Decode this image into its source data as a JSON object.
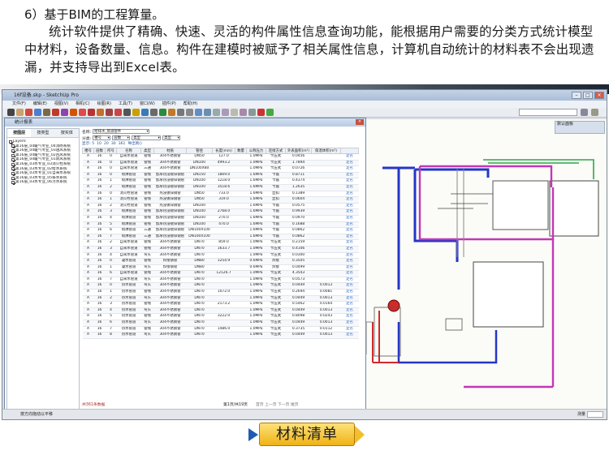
{
  "slide": {
    "heading": "6）基于BIM的工程算量。",
    "paragraph": "统计软件提供了精确、快速、灵活的构件属性信息查询功能，能根据用户需要的分类方式统计模型中材料，设备数量、信息。构件在建模时被赋予了相关属性信息，计算机自动统计的材料表不会出现遗漏，并支持导出到Excel表。"
  },
  "app": {
    "title": "16f设备.skp - SketchUp Pro",
    "menu": [
      "文件(F)",
      "编辑(E)",
      "视图(V)",
      "相机(C)",
      "绘图(R)",
      "工具(T)",
      "窗口(W)",
      "插件(P)",
      "帮助(H)"
    ],
    "status_text": "按方向拖动以平移",
    "status_right": "测量",
    "tray_title": "默认面板"
  },
  "dialog": {
    "title": "统计报表",
    "close_glyph": "×",
    "tabs": [
      "按图层",
      "按类型",
      "按实体"
    ],
    "tree": [
      {
        "label": "Layer0",
        "checked": true,
        "child": false
      },
      {
        "label": "第16层_04暖气专业_04消防系统",
        "checked": true,
        "child": true
      },
      {
        "label": "第16层_04暖气专业_03送风系统",
        "checked": true,
        "child": true
      },
      {
        "label": "第16层_04暖气专业_02回风系统",
        "checked": true,
        "child": true
      },
      {
        "label": "第16层_04暖气专业_01新风系统",
        "checked": true,
        "child": true
      },
      {
        "label": "第16层_03水专业_03消火栓系统",
        "checked": true,
        "child": true
      },
      {
        "label": "第16层_03水专业_02给水系统",
        "checked": true,
        "child": true
      },
      {
        "label": "第16层_03水专业_01自来水系统",
        "checked": true,
        "child": true
      },
      {
        "label": "第16层_03水专业_05排水系统",
        "checked": true,
        "child": true
      },
      {
        "label": "第16层_03水专业_06污水系统",
        "checked": true,
        "child": true
      }
    ],
    "filters": {
      "name_label": "名称:",
      "name_value": "给排水_管道管件",
      "type_label": "分类:",
      "sel1": "楼号",
      "sel2": "层数",
      "sel3": "类型",
      "sel4": "类型"
    },
    "counts": [
      "显示: 5",
      "10",
      "20",
      "30",
      "361",
      "导出到()"
    ],
    "columns": [
      "楼号",
      "层数",
      "所号",
      "名称",
      "类型",
      "材质",
      "管径",
      "长度(mm)",
      "数量",
      "公称压力",
      "连接方式",
      "外表面积(m²)",
      "保温体积(m³)",
      ""
    ],
    "rows": [
      [
        "A",
        "16",
        "0",
        "自来水管道",
        "管线",
        "304不锈钢管",
        "DN50",
        "127.0",
        "",
        "1.0MPa",
        "卡压式",
        "0.0456",
        "",
        "定名"
      ],
      [
        "A",
        "16",
        "0",
        "自来水管道",
        "管线",
        "304不锈钢管",
        "DN100",
        "4993.2",
        "",
        "1.0MPa",
        "卡压式",
        "1.7894",
        "",
        "定名"
      ],
      [
        "A",
        "16",
        "0",
        "自来水管道",
        "三通",
        "304不锈钢管",
        "DN100X80",
        "",
        "",
        "1.0MPa",
        "卡压式",
        "0.0726",
        "",
        "定名"
      ],
      [
        "A",
        "16",
        "0",
        "喷淋管道",
        "管线",
        "加厚热浸镀锌钢管",
        "DN150",
        "1869.0",
        "",
        "1.6MPa",
        "卡箍",
        "0.8711",
        "",
        "定名"
      ],
      [
        "A",
        "16",
        "1",
        "喷淋管道",
        "管线",
        "加厚热浸镀锌钢管",
        "DN100",
        "1218.0",
        "",
        "1.6MPa",
        "卡箍",
        "0.4374",
        "",
        "定名"
      ],
      [
        "A",
        "16",
        "2",
        "喷淋管道",
        "管线",
        "加厚热浸镀锌钢管",
        "DN100",
        "3518.6",
        "",
        "1.6MPa",
        "卡箍",
        "1.2635",
        "",
        "定名"
      ],
      [
        "A",
        "16",
        "0",
        "消火栓管道",
        "管线",
        "热浸镀锌钢管",
        "DN50",
        "733.0",
        "",
        "1.6MPa",
        "丝扣",
        "0.1389",
        "",
        "定名"
      ],
      [
        "A",
        "16",
        "1",
        "消火栓管道",
        "管线",
        "热浸镀锌钢管",
        "DN50",
        "319.0",
        "",
        "1.6MPa",
        "丝扣",
        "0.0604",
        "",
        "定名"
      ],
      [
        "A",
        "16",
        "2",
        "消火栓管道",
        "管线",
        "热浸镀锌钢管",
        "DN100",
        "",
        "",
        "1.6MPa",
        "卡箍",
        "0.0575",
        "",
        "定名"
      ],
      [
        "A",
        "16",
        "3",
        "喷淋管道",
        "管线",
        "加厚热浸镀锌钢管",
        "DN100",
        "2768.0",
        "",
        "1.6MPa",
        "卡箍",
        "0.9939",
        "",
        "定名"
      ],
      [
        "A",
        "16",
        "4",
        "喷淋管道",
        "管线",
        "加厚热浸镀锌钢管",
        "DN100",
        "270.0",
        "",
        "1.6MPa",
        "卡箍",
        "0.0970",
        "",
        "定名"
      ],
      [
        "A",
        "16",
        "5",
        "喷淋管道",
        "管线",
        "加厚热浸镀锌钢管",
        "DN100",
        "470.0",
        "",
        "1.6MPa",
        "卡箍",
        "0.1688",
        "",
        "定名"
      ],
      [
        "A",
        "16",
        "6",
        "喷淋管道",
        "三通",
        "加厚热浸镀锌钢管",
        "DN100X100",
        "",
        "",
        "1.6MPa",
        "卡箍",
        "0.0862",
        "",
        "定名"
      ],
      [
        "A",
        "16",
        "7",
        "喷淋管道",
        "三通",
        "加厚热浸镀锌钢管",
        "DN100X100",
        "",
        "",
        "1.6MPa",
        "卡箍",
        "0.0862",
        "",
        "定名"
      ],
      [
        "A",
        "16",
        "2",
        "自来水管道",
        "管线",
        "304不锈钢管",
        "DN70",
        "859.0",
        "",
        "1.0MPa",
        "卡压式",
        "0.2159",
        "",
        "定名"
      ],
      [
        "A",
        "16",
        "3",
        "自来水管道",
        "管线",
        "304不锈钢管",
        "DN70",
        "1633.7",
        "",
        "1.0MPa",
        "卡压式",
        "0.4106",
        "",
        "定名"
      ],
      [
        "A",
        "16",
        "4",
        "自来水管道",
        "弯头",
        "304不锈钢管",
        "DN70",
        "",
        "",
        "1.0MPa",
        "卡压式",
        "0.0300",
        "",
        "定名"
      ],
      [
        "A",
        "16",
        "0",
        "凝水管道",
        "管线",
        "焊接钢管",
        "DN80",
        "1254.9",
        "",
        "0.6MPa",
        "焊接",
        "0.3505",
        "",
        "定名"
      ],
      [
        "A",
        "16",
        "1",
        "凝水管道",
        "弯头",
        "焊接钢管",
        "DN80",
        "",
        "",
        "0.6MPa",
        "焊接",
        "0.0499",
        "",
        "定名"
      ],
      [
        "A",
        "16",
        "6",
        "自来水管道",
        "管线",
        "304不锈钢管",
        "DN70",
        "12126.7",
        "",
        "1.0MPa",
        "卡压式",
        "4.3543",
        "",
        "定名"
      ],
      [
        "A",
        "16",
        "7",
        "自来水管道",
        "弯头",
        "304不锈钢管",
        "DN70",
        "",
        "",
        "1.0MPa",
        "卡压式",
        "0.0573",
        "",
        "定名"
      ],
      [
        "A",
        "16",
        "0",
        "热水管道",
        "弯头",
        "304不锈钢管",
        "DN70",
        "",
        "",
        "1.0MPa",
        "卡压式",
        "0.0449",
        "0.0013",
        "定名"
      ],
      [
        "A",
        "16",
        "1",
        "热水管道",
        "管线",
        "304不锈钢管",
        "DN70",
        "1072.0",
        "",
        "1.0MPa",
        "卡压式",
        "0.2694",
        "0.0081",
        "定名"
      ],
      [
        "A",
        "16",
        "2",
        "热水管道",
        "弯头",
        "304不锈钢管",
        "DN70",
        "",
        "",
        "1.0MPa",
        "卡压式",
        "0.0449",
        "0.0013",
        "定名"
      ],
      [
        "A",
        "16",
        "3",
        "热水管道",
        "管线",
        "304不锈钢管",
        "DN70",
        "2173.2",
        "",
        "1.0MPa",
        "卡压式",
        "0.5462",
        "0.0164",
        "定名"
      ],
      [
        "A",
        "16",
        "4",
        "热水管道",
        "弯头",
        "304不锈钢管",
        "DN70",
        "",
        "",
        "1.0MPa",
        "卡压式",
        "0.0449",
        "0.0013",
        "定名"
      ],
      [
        "A",
        "16",
        "5",
        "热水管道",
        "管线",
        "304不锈钢管",
        "DN70",
        "3222.0",
        "",
        "1.0MPa",
        "卡压式",
        "0.8098",
        "0.0243",
        "定名"
      ],
      [
        "A",
        "16",
        "6",
        "热水管道",
        "弯头",
        "304不锈钢管",
        "DN70",
        "",
        "",
        "1.0MPa",
        "卡压式",
        "0.0449",
        "0.0013",
        "定名"
      ],
      [
        "A",
        "16",
        "7",
        "热水管道",
        "管线",
        "304不锈钢管",
        "DN70",
        "1486.0",
        "",
        "1.0MPa",
        "卡压式",
        "0.3735",
        "0.0112",
        "定名"
      ],
      [
        "A",
        "16",
        "8",
        "热水管道",
        "弯头",
        "304不锈钢管",
        "DN70",
        "",
        "",
        "1.0MPa",
        "卡压式",
        "0.0449",
        "0.0013",
        "定名"
      ]
    ],
    "footer_total": "共361条数据",
    "footer_page": "第1页/共19页",
    "footer_nav": "首页 上一页 下一页 尾页"
  },
  "callout": {
    "label": "材料清单"
  },
  "colors": {
    "link": "#2060c0",
    "callout": "#f0b215",
    "pipe_blue": "#2436c8",
    "pipe_magenta": "#c238b6",
    "pipe_red": "#d12a2a",
    "pipe_green": "#2aa84a"
  }
}
